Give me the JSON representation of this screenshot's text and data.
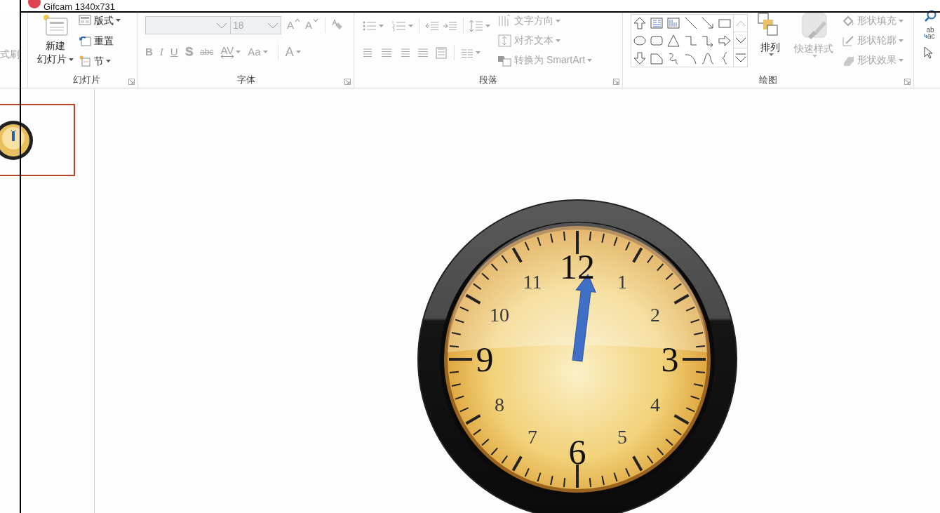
{
  "capture_window": {
    "title": "Gifcam 1340x731"
  },
  "ribbon": {
    "clipboard_fragment": {
      "label": "式刷",
      "disabled": true
    },
    "slides": {
      "label": "幻灯片",
      "new_slide": {
        "label_lines": [
          "新建",
          "幻灯片"
        ],
        "dropdown": true
      },
      "items": [
        {
          "label": "版式",
          "kind": "layout",
          "dropdown": true
        },
        {
          "label": "重置",
          "kind": "reset",
          "dropdown": false
        },
        {
          "label": "节",
          "kind": "section",
          "dropdown": true
        }
      ]
    },
    "font": {
      "label": "字体",
      "disabled": true,
      "font_size": {
        "value": "18"
      },
      "size_buttons": [
        {
          "label": "A",
          "kind": "grow"
        },
        {
          "label": "A",
          "kind": "shrink"
        }
      ],
      "format_buttons": [
        {
          "label": "B",
          "kind": "bold",
          "dropdown": false
        },
        {
          "label": "I",
          "kind": "italic",
          "dropdown": false
        },
        {
          "label": "U",
          "kind": "underline",
          "dropdown": false
        },
        {
          "label": "S",
          "kind": "shadow",
          "dropdown": false
        },
        {
          "label": "abc",
          "kind": "strike",
          "dropdown": false
        },
        {
          "label": "AV",
          "kind": "spacing",
          "dropdown": true
        },
        {
          "label": "Aa",
          "kind": "case",
          "dropdown": true
        },
        {
          "label": "A",
          "kind": "color",
          "dropdown": true
        }
      ]
    },
    "paragraph": {
      "label": "段落",
      "disabled": true,
      "text_buttons": [
        {
          "label": "文字方向",
          "kind": "direction",
          "dropdown": true
        },
        {
          "label": "对齐文本",
          "kind": "align",
          "dropdown": true
        },
        {
          "label": "转换为 SmartArt",
          "kind": "smartart",
          "dropdown": true
        }
      ]
    },
    "drawing": {
      "label": "绘图",
      "arrange": {
        "label": "排列",
        "disabled": false,
        "dropdown": true
      },
      "quick_styles": {
        "label": "快速样式",
        "disabled": true,
        "dropdown": true
      },
      "shape_buttons": [
        {
          "label": "形状填充",
          "kind": "fill",
          "disabled": true,
          "dropdown": true
        },
        {
          "label": "形状轮廓",
          "kind": "outline",
          "disabled": true,
          "dropdown": true
        },
        {
          "label": "形状效果",
          "kind": "effects",
          "disabled": true,
          "dropdown": true
        }
      ]
    },
    "editing": {
      "replace_text": [
        "ab",
        "ac"
      ]
    }
  },
  "slide_panel": {
    "thumbnails": [
      {
        "selected": true
      }
    ]
  },
  "slide": {
    "clock": {
      "numerals": [
        {
          "text": "1",
          "kind": "minor"
        },
        {
          "text": "2",
          "kind": "minor"
        },
        {
          "text": "3",
          "kind": "major"
        },
        {
          "text": "4",
          "kind": "minor"
        },
        {
          "text": "5",
          "kind": "minor"
        },
        {
          "text": "6",
          "kind": "major"
        },
        {
          "text": "7",
          "kind": "minor"
        },
        {
          "text": "8",
          "kind": "minor"
        },
        {
          "text": "9",
          "kind": "major"
        },
        {
          "text": "10",
          "kind": "minor"
        },
        {
          "text": "11",
          "kind": "minor"
        },
        {
          "text": "12",
          "kind": "major"
        }
      ]
    }
  }
}
